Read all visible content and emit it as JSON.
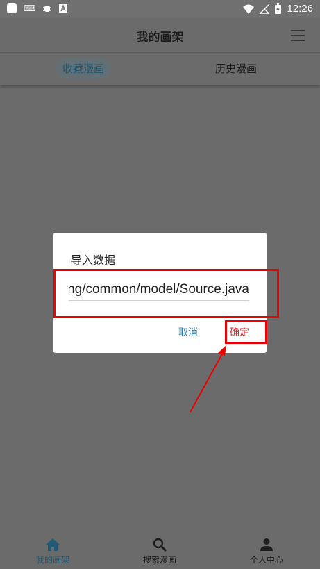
{
  "status_bar": {
    "time": "12:26",
    "icons": [
      "square-icon",
      "keyboard-icon",
      "bug-icon",
      "a-icon",
      "wifi-icon",
      "signal-icon",
      "battery-icon"
    ]
  },
  "app_bar": {
    "title": "我的画架",
    "menu_icon": "menu-icon"
  },
  "tabs": [
    {
      "label": "收藏漫画",
      "selected": true
    },
    {
      "label": "历史漫画",
      "selected": false
    }
  ],
  "dialog": {
    "title": "导入数据",
    "input_value": "ng/common/model/Source.java",
    "cancel_label": "取消",
    "ok_label": "确定"
  },
  "bottom_nav": [
    {
      "label": "我的画架",
      "icon": "home-icon",
      "active": true
    },
    {
      "label": "搜索漫画",
      "icon": "search-icon",
      "active": false
    },
    {
      "label": "个人中心",
      "icon": "person-icon",
      "active": false
    }
  ],
  "colors": {
    "accent": "#1f5a77",
    "annotation": "#ee0000",
    "dialog_button": "#2a83b8",
    "confirm_text": "#d92a2a"
  }
}
